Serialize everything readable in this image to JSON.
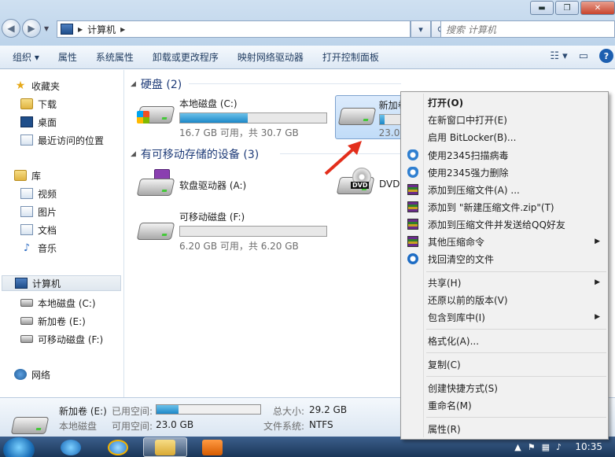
{
  "window": {
    "controls": [
      "▬",
      "❐",
      "✕"
    ]
  },
  "address": {
    "crumb": "计算机",
    "search_placeholder": "搜索 计算机"
  },
  "toolbar": {
    "organize": "组织 ▾",
    "properties": "属性",
    "system_properties": "系统属性",
    "uninstall": "卸载或更改程序",
    "map_drive": "映射网络驱动器",
    "control_panel": "打开控制面板"
  },
  "sidebar": {
    "favorites": "收藏夹",
    "downloads": "下载",
    "desktop": "桌面",
    "recent": "最近访问的位置",
    "libraries": "库",
    "videos": "视频",
    "pictures": "图片",
    "documents": "文档",
    "music": "音乐",
    "computer": "计算机",
    "local_disk": "本地磁盘 (C:)",
    "new_volume": "新加卷 (E:)",
    "removable": "可移动磁盘 (F:)",
    "network": "网络"
  },
  "content": {
    "hdd_group": "硬盘 (2)",
    "removable_group": "有可移动存储的设备 (3)",
    "drives": {
      "c": {
        "name": "本地磁盘 (C:)",
        "size": "16.7 GB 可用，共 30.7 GB",
        "used_fraction": 0.46
      },
      "e": {
        "name": "新加卷",
        "size": "23.0",
        "used_fraction": 0.21
      },
      "a": {
        "name": "软盘驱动器 (A:)"
      },
      "dvd": {
        "name": "DVD"
      },
      "f": {
        "name": "可移动磁盘 (F:)",
        "size": "6.20 GB 可用，共 6.20 GB",
        "used_fraction": 0.0
      }
    }
  },
  "status": {
    "name": "新加卷 (E:)",
    "type": "本地磁盘",
    "used_label": "已用空间:",
    "free_label": "可用空间:",
    "free_value": "23.0 GB",
    "total_label": "总大小:",
    "total_value": "29.2 GB",
    "fs_label": "文件系统:",
    "fs_value": "NTFS",
    "used_fraction": 0.21
  },
  "taskbar": {
    "clock": "10:35"
  },
  "context_menu": {
    "open": "打开(O)",
    "open_new_window": "在新窗口中打开(E)",
    "bitlocker": "启用 BitLocker(B)...",
    "scan_2345": "使用2345扫描病毒",
    "delete_2345": "使用2345强力删除",
    "add_archive": "添加到压缩文件(A) ...",
    "add_zip": "添加到 \"新建压缩文件.zip\"(T)",
    "add_send_qq": "添加到压缩文件并发送给QQ好友",
    "other_compress": "其他压缩命令",
    "recover": "找回清空的文件",
    "share": "共享(H)",
    "restore": "还原以前的版本(V)",
    "include_library": "包含到库中(I)",
    "format": "格式化(A)...",
    "copy": "复制(C)",
    "create_shortcut": "创建快捷方式(S)",
    "rename": "重命名(M)",
    "properties": "属性(R)"
  }
}
